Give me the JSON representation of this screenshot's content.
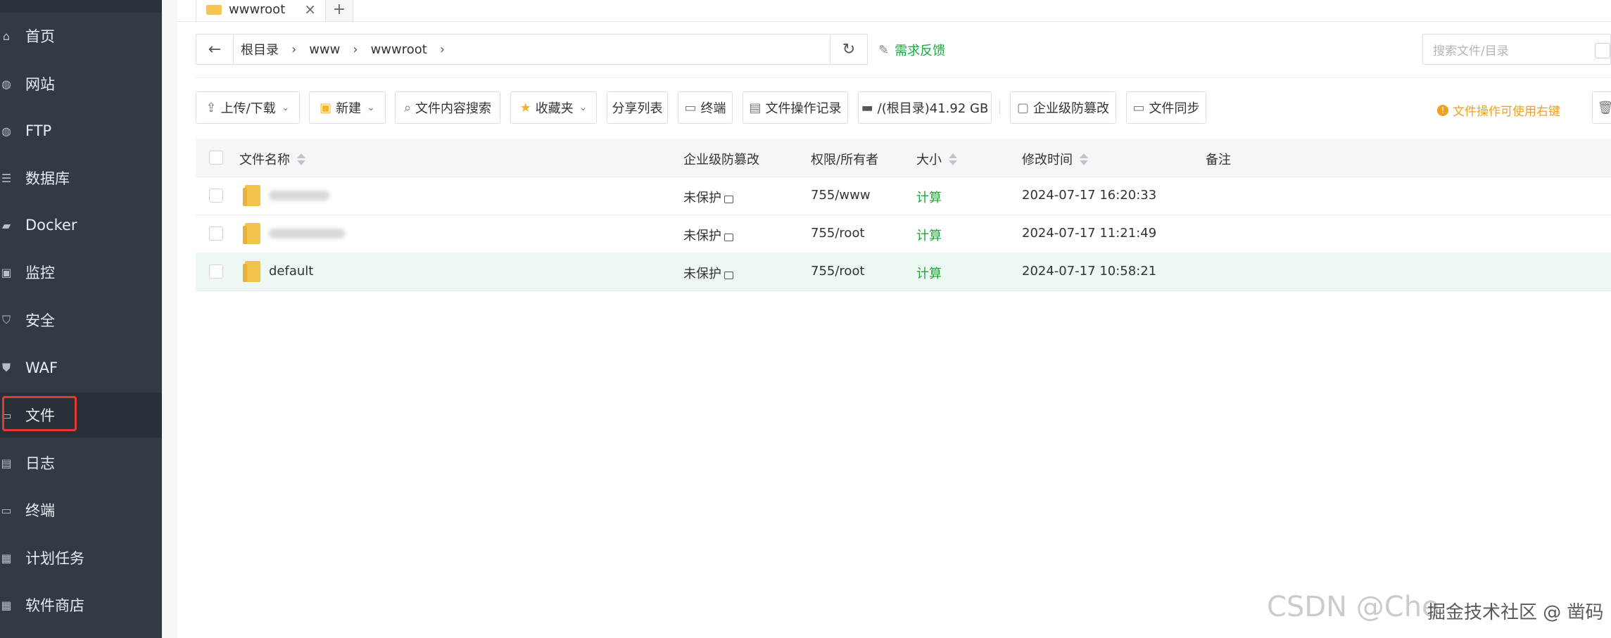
{
  "sidebar": {
    "items": [
      {
        "label": "首页",
        "icon": "home-icon"
      },
      {
        "label": "网站",
        "icon": "globe-icon"
      },
      {
        "label": "FTP",
        "icon": "globe-icon"
      },
      {
        "label": "数据库",
        "icon": "database-icon"
      },
      {
        "label": "Docker",
        "icon": "docker-icon"
      },
      {
        "label": "监控",
        "icon": "monitor-icon"
      },
      {
        "label": "安全",
        "icon": "shield-icon"
      },
      {
        "label": "WAF",
        "icon": "waf-shield-icon"
      },
      {
        "label": "文件",
        "icon": "folder-icon"
      },
      {
        "label": "日志",
        "icon": "log-icon"
      },
      {
        "label": "终端",
        "icon": "terminal-icon"
      },
      {
        "label": "计划任务",
        "icon": "calendar-icon"
      },
      {
        "label": "软件商店",
        "icon": "grid-icon"
      }
    ],
    "active": "文件"
  },
  "tabs": {
    "current": "wwwroot",
    "add": "+"
  },
  "path": {
    "crumbs": [
      "根目录",
      "www",
      "wwwroot"
    ],
    "feedback": "需求反馈",
    "search_placeholder": "搜索文件/目录"
  },
  "toolbar": {
    "upload": "上传/下载",
    "new": "新建",
    "content_search": "文件内容搜索",
    "favorites": "收藏夹",
    "share_list": "分享列表",
    "terminal": "终端",
    "op_log": "文件操作记录",
    "disk": "/(根目录)41.92 GB",
    "tamper": "企业级防篡改",
    "sync": "文件同步",
    "tip": "文件操作可使用右键"
  },
  "table": {
    "headers": {
      "name": "文件名称",
      "tamper": "企业级防篡改",
      "perm": "权限/所有者",
      "size": "大小",
      "mtime": "修改时间",
      "note": "备注"
    },
    "rows": [
      {
        "name": "",
        "tamper": "未保护",
        "perm": "755/www",
        "size": "计算",
        "mtime": "2024-07-17 16:20:33"
      },
      {
        "name": "",
        "tamper": "未保护",
        "perm": "755/root",
        "size": "计算",
        "mtime": "2024-07-17 11:21:49"
      },
      {
        "name": "default",
        "tamper": "未保护",
        "perm": "755/root",
        "size": "计算",
        "mtime": "2024-07-17 10:58:21"
      }
    ]
  },
  "watermark": {
    "csdn": "CSDN @Che",
    "juejin": "掘金技术社区 @ 凿码"
  },
  "colors": {
    "sidebar_bg": "#323a44",
    "accent_green": "#20a53a",
    "tip_orange": "#f0a020",
    "highlight_red": "#e53935"
  }
}
